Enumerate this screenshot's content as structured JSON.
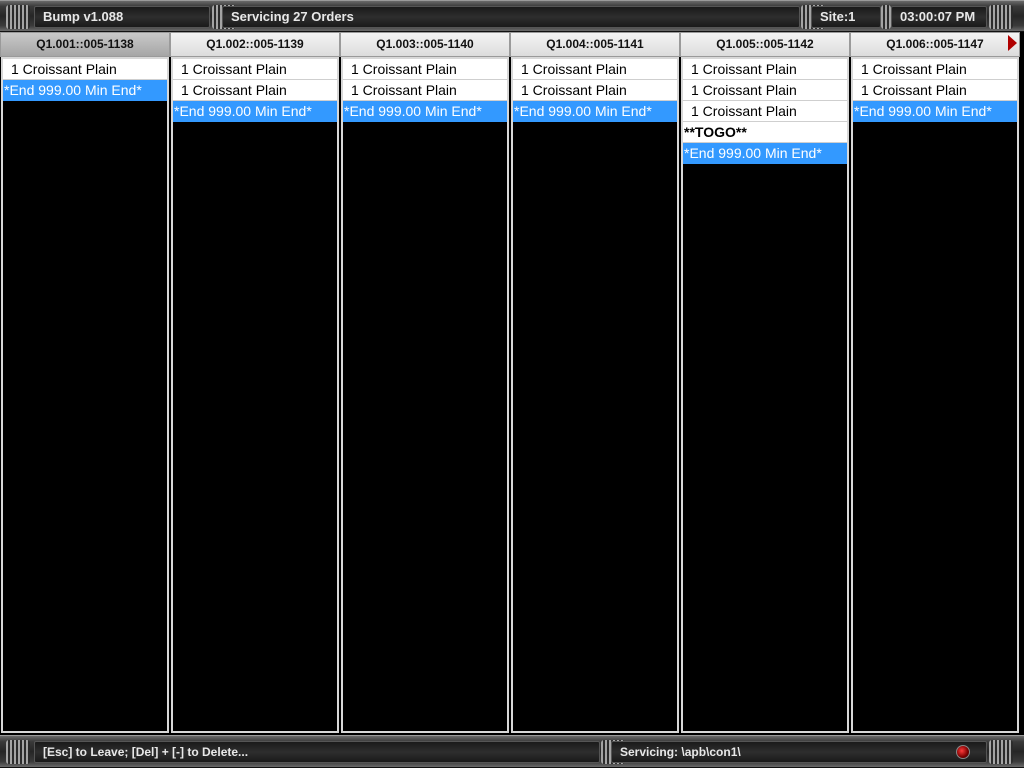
{
  "top_bar": {
    "app_title": "Bump v1.088",
    "status": "Servicing 27 Orders",
    "site": "Site:1",
    "clock": "03:00:07 PM"
  },
  "orders": [
    {
      "header": "Q1.001::005-1138",
      "selected": true,
      "items": [
        "1 Croissant Plain"
      ],
      "note": null,
      "end": "*End 999.00 Min End*"
    },
    {
      "header": "Q1.002::005-1139",
      "selected": false,
      "items": [
        "1 Croissant Plain",
        "1 Croissant Plain"
      ],
      "note": null,
      "end": "*End 999.00 Min End*"
    },
    {
      "header": "Q1.003::005-1140",
      "selected": false,
      "items": [
        "1 Croissant Plain",
        "1 Croissant Plain"
      ],
      "note": null,
      "end": "*End 999.00 Min End*"
    },
    {
      "header": "Q1.004::005-1141",
      "selected": false,
      "items": [
        "1 Croissant Plain",
        "1 Croissant Plain"
      ],
      "note": null,
      "end": "*End 999.00 Min End*"
    },
    {
      "header": "Q1.005::005-1142",
      "selected": false,
      "items": [
        "1 Croissant Plain",
        "1 Croissant Plain",
        "1 Croissant Plain"
      ],
      "note": "**TOGO**",
      "end": "*End 999.00 Min End*"
    },
    {
      "header": "Q1.006::005-1147",
      "selected": false,
      "items": [
        "1 Croissant Plain",
        "1 Croissant Plain"
      ],
      "note": null,
      "end": "*End 999.00 Min End*"
    }
  ],
  "bottom_bar": {
    "hint": "[Esc] to Leave; [Del] + [-] to Delete...",
    "servicing": "Servicing: \\apb\\con1\\"
  },
  "colors": {
    "highlight": "#3399ff",
    "next_arrow": "#b00000"
  },
  "icons": {
    "next_page": "right-triangle-icon",
    "status_light": "red-dot-icon"
  }
}
